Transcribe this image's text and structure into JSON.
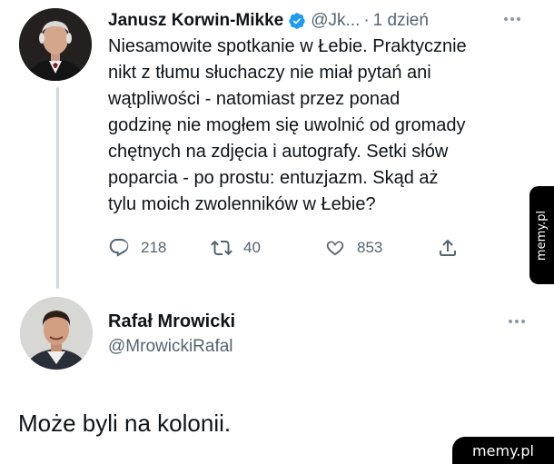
{
  "tweet": {
    "author_name": "Janusz Korwin-Mikke",
    "author_handle": "@Jk...",
    "separator": "·",
    "time": "1 dzień",
    "text": "Niesamowite spotkanie w Łebie. Praktycznie\nnikt z tłumu słuchaczy nie miał pytań ani\nwątpliwości - natomiast przez ponad\ngodzinę nie mogłem się uwolnić od gromady\nchętnych na zdjęcia i autografy. Setki słów\npoparcia - po prostu: entuzjazm. Skąd aż\ntylu moich zwolenników w Łebie?",
    "replies": "218",
    "retweets": "40",
    "likes": "853",
    "verified_color": "#1d9bf0",
    "icons": [
      "verified-badge-icon",
      "more-icon",
      "reply-icon",
      "retweet-icon",
      "like-icon",
      "share-icon"
    ]
  },
  "reply": {
    "author_name": "Rafał Mrowicki",
    "author_handle": "@MrowickiRafal",
    "text": "Może byli na kolonii.",
    "icons": [
      "more-icon"
    ]
  },
  "watermark": {
    "side": "memy.pl",
    "bottom": "memy.pl"
  },
  "colors": {
    "text": "#0f1419",
    "secondary": "#536471",
    "thread_line": "#cfd9de"
  }
}
